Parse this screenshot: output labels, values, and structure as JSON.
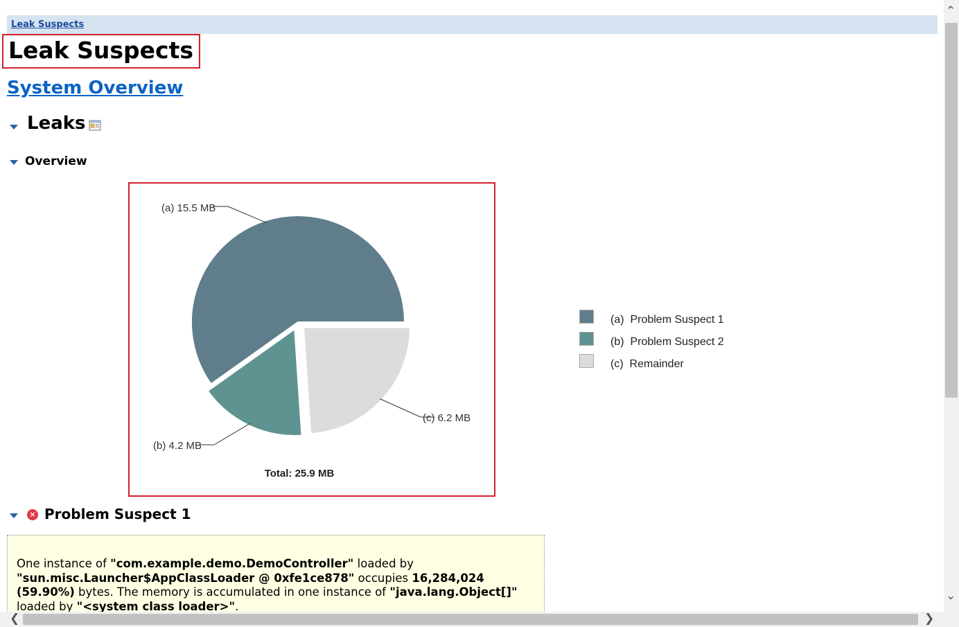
{
  "breadcrumb": {
    "label": "Leak Suspects"
  },
  "page": {
    "title": "Leak Suspects",
    "system_overview_link": "System Overview"
  },
  "sections": {
    "leaks": "Leaks",
    "overview": "Overview",
    "problem_suspect_1": "Problem Suspect 1"
  },
  "chart_data": {
    "type": "pie",
    "title": "",
    "total_label": "Total: 25.9 MB",
    "slices": [
      {
        "id": "a",
        "label": "(a)  15.5 MB",
        "value": 15.5,
        "legend": "(a)  Problem Suspect 1",
        "color": "#607d8b",
        "exploded": false
      },
      {
        "id": "b",
        "label": "(b)  4.2 MB",
        "value": 4.2,
        "legend": "(b)  Problem Suspect 2",
        "color": "#5f9392",
        "exploded": true
      },
      {
        "id": "c",
        "label": "(c)  6.2 MB",
        "value": 6.2,
        "legend": "(c)  Remainder",
        "color": "#dcdcdc",
        "exploded": true
      }
    ],
    "legend_position": "right"
  },
  "suspect_1": {
    "t1": "One instance of ",
    "b1": "\"com.example.demo.DemoController\"",
    "t2": " loaded by ",
    "b2": "\"sun.misc.Launcher$AppClassLoader @ 0xfe1ce878\"",
    "t3": " occupies ",
    "b3": "16,284,024 (59.90%)",
    "t4": " bytes. The memory is accumulated in one instance of ",
    "b4": "\"java.lang.Object[]\"",
    "t5": " loaded by ",
    "b5": "\"<system class loader>\"",
    "t6": "."
  },
  "icons": {
    "collapse": "triangle-down-icon",
    "details": "details-icon",
    "error": "error-icon"
  }
}
